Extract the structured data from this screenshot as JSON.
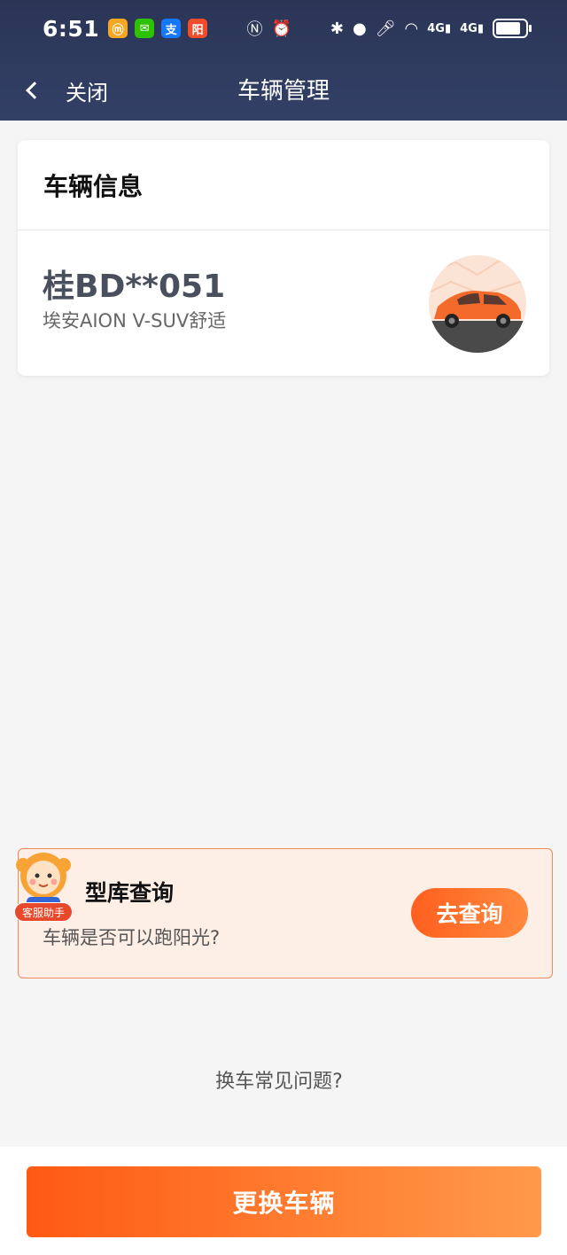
{
  "status_bar": {
    "time": "6:51",
    "app_icons": [
      {
        "name": "shopping-app-icon",
        "glyph": "ⓜ",
        "color": "#f5a623"
      },
      {
        "name": "wechat-icon",
        "glyph": "✉",
        "color": "#2dc100"
      },
      {
        "name": "alipay-icon",
        "glyph": "支",
        "color": "#1677ff"
      },
      {
        "name": "yangguang-app-icon",
        "glyph": "阳",
        "color": "#f24c2b"
      }
    ],
    "sys_icons": [
      "nfc-icon",
      "alarm-icon",
      "bluetooth-icon",
      "location-icon",
      "mic-icon",
      "wifi-icon",
      "signal-4g-icon",
      "signal-4g-2-icon"
    ],
    "battery_level": 0.85
  },
  "nav": {
    "back_label": "关闭",
    "title": "车辆管理"
  },
  "vehicle_card": {
    "header": "车辆信息",
    "plate": "桂BD**051",
    "model": "埃安AION V-SUV舒适"
  },
  "query_card": {
    "title": "型库查询",
    "subtitle": "车辆是否可以跑阳光?",
    "button": "去查询",
    "assistant_label": "客服助手"
  },
  "faq": {
    "link": "换车常见问题?"
  },
  "bottom": {
    "button": "更换车辆"
  },
  "colors": {
    "header_bg": "#2a3556",
    "accent": "#ff5f1f",
    "page_bg": "#f5f5f5"
  }
}
